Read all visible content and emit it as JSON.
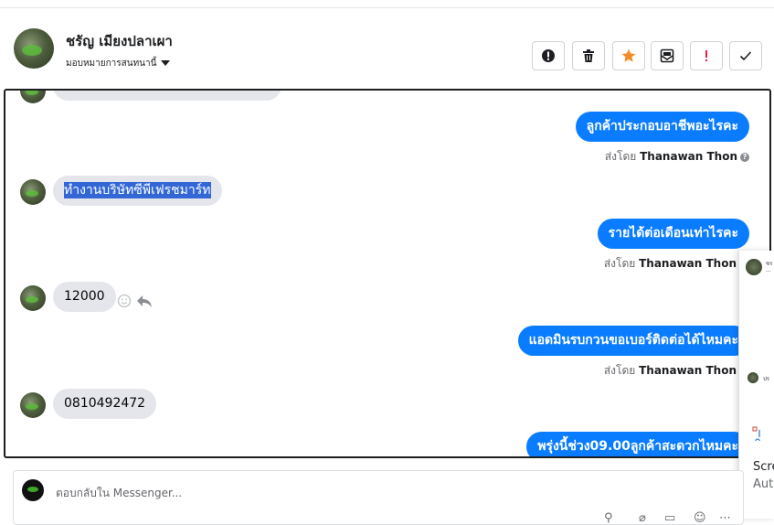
{
  "header": {
    "contact_name": "ชรัญ เมียงปลาเผา",
    "assign_label": "มอบหมายการสนทนานี้"
  },
  "toolbar": {
    "buttons": [
      "alert-circle-icon",
      "trash-icon",
      "star-icon",
      "archive-icon",
      "exclamation-icon",
      "check-icon"
    ],
    "star_color": "#f28c28",
    "exclamation_color": "#e41e3f"
  },
  "messages": [
    {
      "from": "agent",
      "text": "ลูกค้าประกอบอาชีพอะไรคะ",
      "sent_by_label": "ส่งโดย",
      "sent_by_name": "Thanawan Thon"
    },
    {
      "from": "customer",
      "text": "ทำงานบริษัทซีพีเฟรชมาร์ท",
      "highlighted": true
    },
    {
      "from": "agent",
      "text": "รายได้ต่อเดือนเท่าไรคะ",
      "sent_by_label": "ส่งโดย",
      "sent_by_name": "Thanawan Thon"
    },
    {
      "from": "customer",
      "text": "12000"
    },
    {
      "from": "agent",
      "text": "แอดมินรบกวนขอเบอร์ติดต่อได้ไหมคะ",
      "sent_by_label": "ส่งโดย",
      "sent_by_name": "Thanawan Thon"
    },
    {
      "from": "customer",
      "text": "0810492472"
    },
    {
      "from": "agent",
      "text": "พรุ่งนี้ช่วง09.00ลูกค้าสะดวกไหมคะ"
    }
  ],
  "side_panel": {
    "title_partial": "Scre",
    "subtitle_partial": "Auto"
  },
  "composer": {
    "placeholder": "ตอบกลับใน Messenger..."
  },
  "colors": {
    "accent": "#0a7cff",
    "incoming_bubble": "#e4e6eb"
  }
}
